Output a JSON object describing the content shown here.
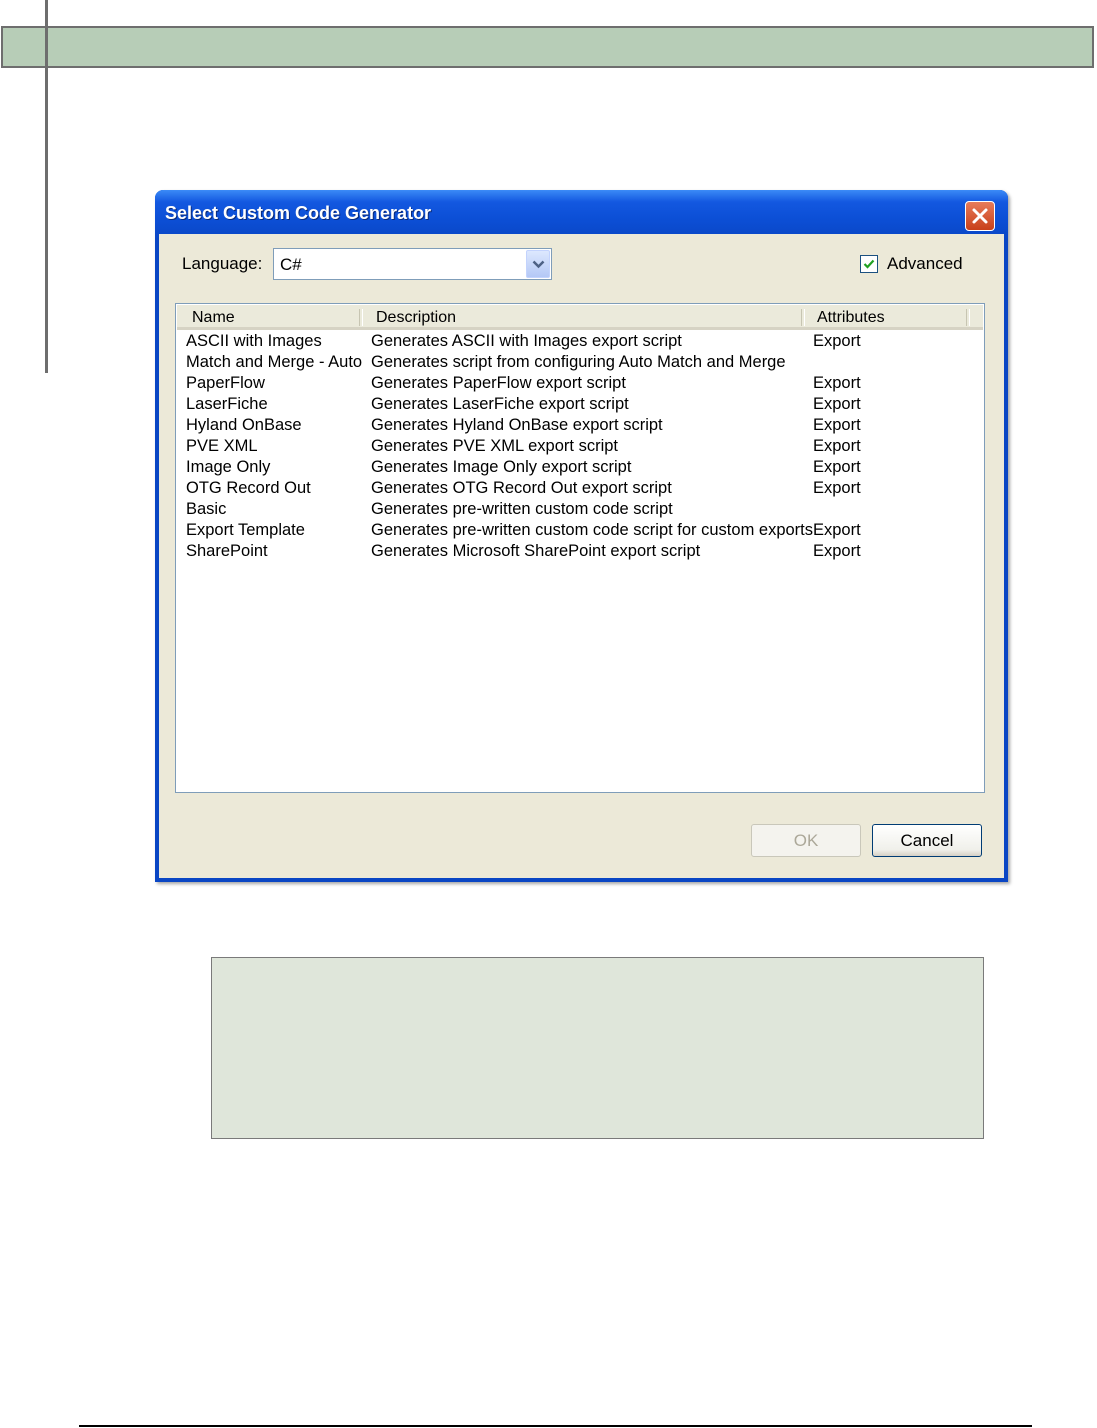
{
  "dialog": {
    "title": "Select Custom Code Generator",
    "language_label": "Language:",
    "language_value": "C#",
    "advanced_label": "Advanced",
    "advanced_checked": true,
    "columns": [
      "Name",
      "Description",
      "Attributes"
    ],
    "rows": [
      {
        "name": "ASCII with Images",
        "description": "Generates ASCII with Images export script",
        "attributes": "Export"
      },
      {
        "name": "Match and Merge - Auto",
        "description": "Generates script from configuring Auto Match and Merge",
        "attributes": ""
      },
      {
        "name": "PaperFlow",
        "description": "Generates PaperFlow export script",
        "attributes": "Export"
      },
      {
        "name": "LaserFiche",
        "description": "Generates LaserFiche export script",
        "attributes": "Export"
      },
      {
        "name": "Hyland OnBase",
        "description": "Generates Hyland OnBase export script",
        "attributes": "Export"
      },
      {
        "name": "PVE XML",
        "description": "Generates PVE XML export script",
        "attributes": "Export"
      },
      {
        "name": "Image Only",
        "description": "Generates Image Only export script",
        "attributes": "Export"
      },
      {
        "name": "OTG Record Out",
        "description": "Generates OTG Record Out export script",
        "attributes": "Export"
      },
      {
        "name": "Basic",
        "description": "Generates pre-written custom code script",
        "attributes": ""
      },
      {
        "name": "Export Template",
        "description": "Generates pre-written custom code script for custom exports",
        "attributes": "Export"
      },
      {
        "name": "SharePoint",
        "description": "Generates Microsoft SharePoint export script",
        "attributes": "Export"
      }
    ],
    "ok_label": "OK",
    "cancel_label": "Cancel"
  },
  "icons": {
    "close": "close-icon",
    "dropdown": "chevron-down-icon",
    "check": "checkmark-icon"
  },
  "colors": {
    "titlebar": "#0a47c6",
    "dialog_face": "#ece9d8",
    "doc_band": "#b7cdb7",
    "note_box": "#dfe6da"
  }
}
